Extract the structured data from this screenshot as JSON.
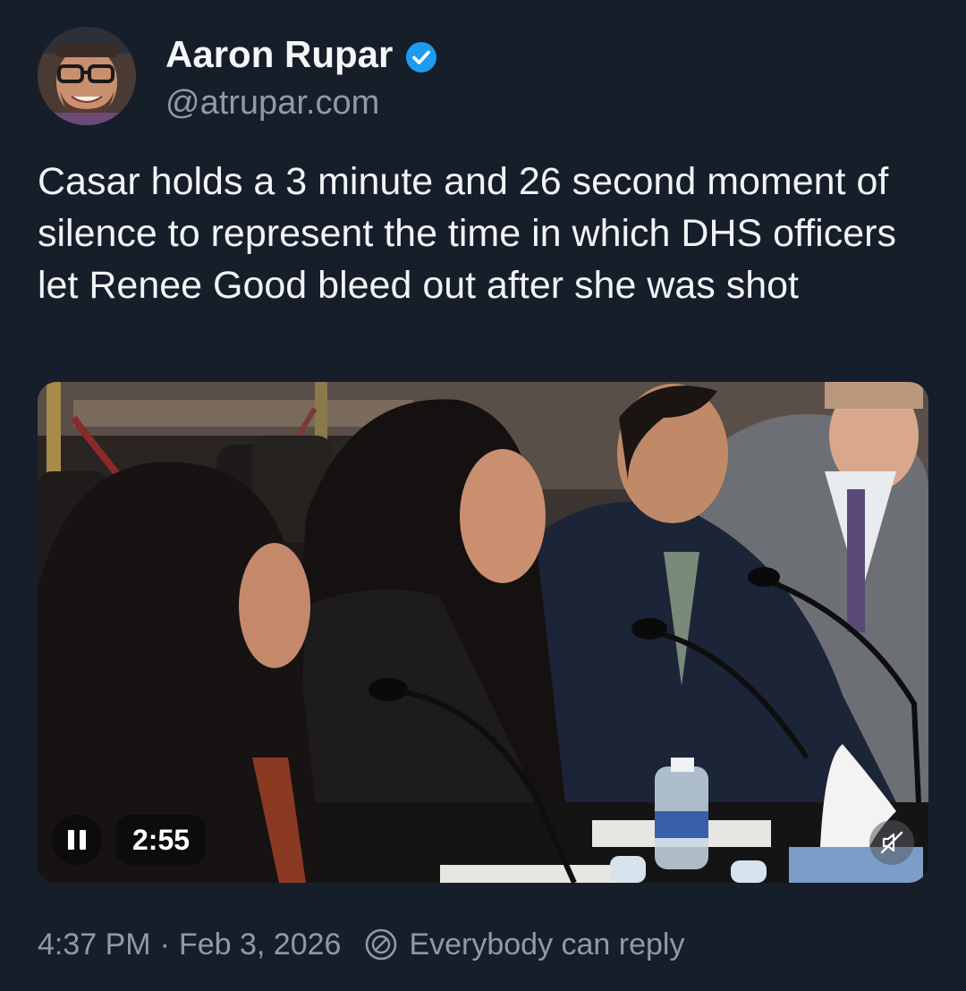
{
  "author": {
    "display_name": "Aaron Rupar",
    "handle": "@atrupar.com",
    "verified_icon": "verified-badge-icon",
    "verified_color": "#1d9bf0"
  },
  "post": {
    "text": "Casar holds a 3 minute and 26 second moment of silence to represent the time in which DHS officers let Renee Good bleed out after she was shot"
  },
  "video": {
    "elapsed": "2:55",
    "pause_icon": "pause-icon",
    "mute_icon": "muted-speaker-icon"
  },
  "meta": {
    "time": "4:37 PM",
    "separator": "·",
    "date": "Feb 3, 2026",
    "reply_setting": "Everybody can reply",
    "reply_icon": "reply-permission-icon"
  },
  "colors": {
    "background": "#161e2a",
    "primary_text": "#f1f3f5",
    "secondary_text": "#8f9aa8"
  }
}
